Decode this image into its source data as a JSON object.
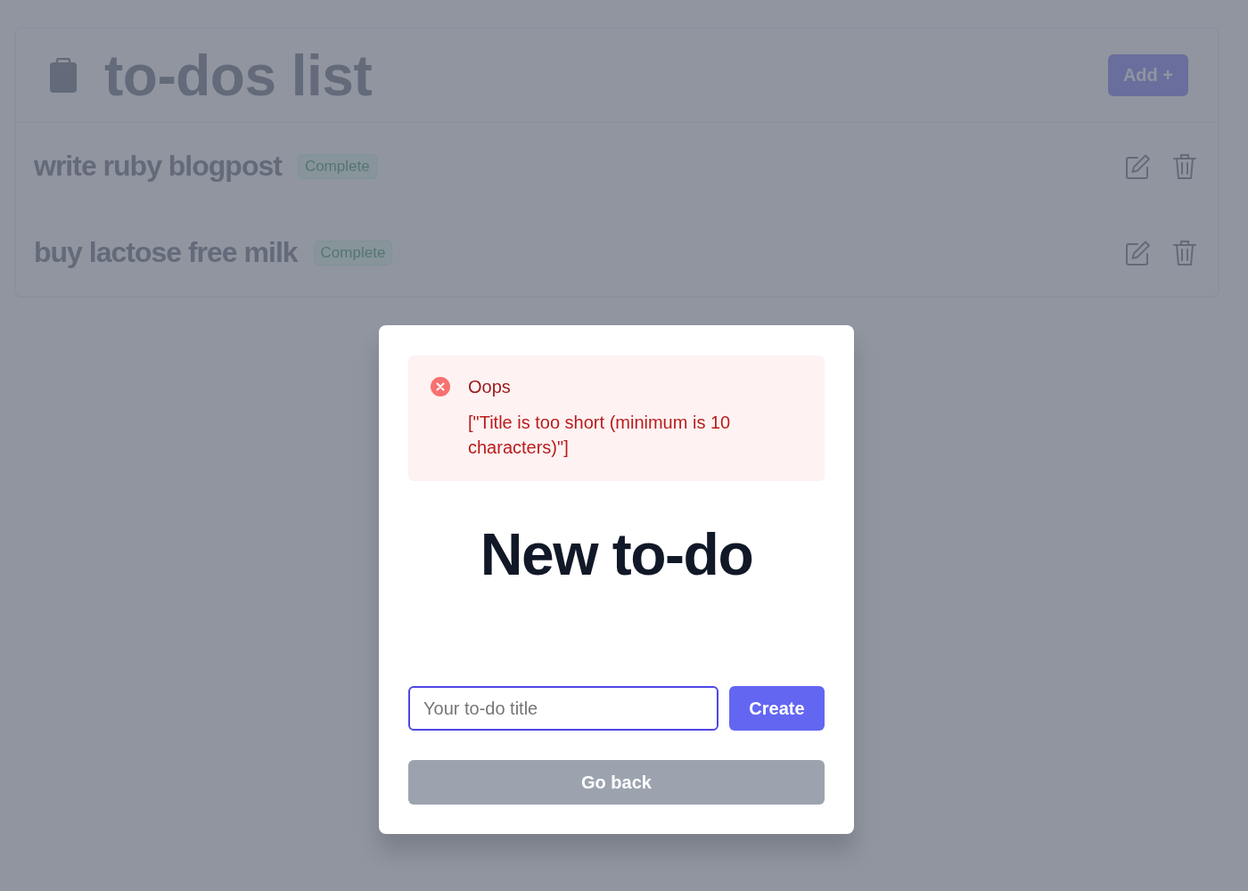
{
  "header": {
    "title": "to-dos list",
    "add_button": "Add +"
  },
  "todos": [
    {
      "title": "write ruby blogpost",
      "status": "Complete"
    },
    {
      "title": "buy lactose free milk",
      "status": "Complete"
    }
  ],
  "modal": {
    "alert": {
      "title": "Oops",
      "message": "[\"Title is too short (minimum is 10 characters)\"]"
    },
    "heading": "New to-do",
    "input": {
      "placeholder": "Your to-do title",
      "focused": true
    },
    "create_button": "Create",
    "back_button": "Go back"
  }
}
